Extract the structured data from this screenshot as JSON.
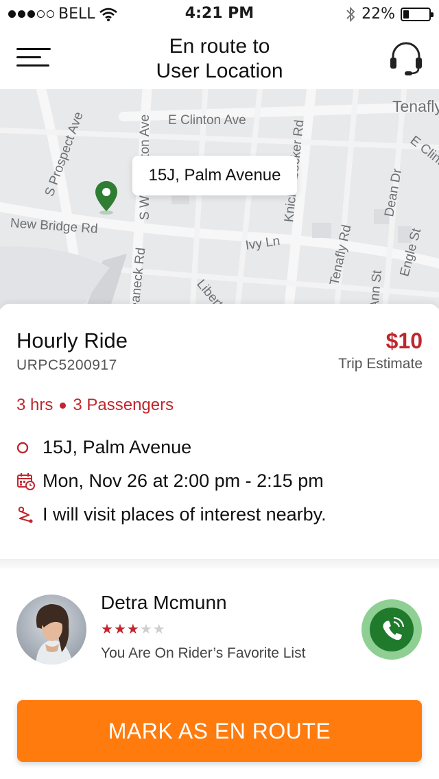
{
  "status_bar": {
    "carrier": "BELL",
    "time": "4:21 PM",
    "battery_text": "22%",
    "battery_level": 0.22,
    "signal_filled": 3,
    "signal_total": 5
  },
  "header": {
    "title": "En route to User Location",
    "title_line1": "En route to",
    "title_line2": "User Location",
    "menu_icon": "hamburger-menu-icon",
    "support_icon": "headset-icon"
  },
  "map": {
    "callout": "15J, Palm Avenue",
    "labels": {
      "prospect": "S Prospect Ave",
      "washington": "S Washington Ave",
      "clinton": "E Clinton Ave",
      "knick": "Knickerbocker Rd",
      "tenafly_town": "Tenafly",
      "eclin": "E Clinton Ave",
      "dean": "Dean Dr",
      "new_bridge": "New Bridge Rd",
      "ivy": "Ivy Ln",
      "tenafly_rd": "Tenafly Rd",
      "engle": "Engle St",
      "teaneck": "Teaneck Rd",
      "liberty": "Liberty",
      "ann": "Ann St"
    },
    "pin_color": "#2e7d32"
  },
  "trip": {
    "ride_type": "Hourly Ride",
    "ride_id": "URPC5200917",
    "fare": "$10",
    "fare_label": "Trip Estimate",
    "duration": "3 hrs",
    "passengers": "3 Passengers",
    "pickup": "15J, Palm Avenue",
    "schedule": "Mon, Nov 26 at 2:00 pm - 2:15 pm",
    "note": "I will visit places of interest nearby."
  },
  "rider": {
    "name": "Detra Mcmunn",
    "rating": 3,
    "rating_max": 5,
    "note": "You Are On Rider’s Favorite List"
  },
  "action": {
    "label": "MARK AS EN ROUTE"
  },
  "colors": {
    "accent": "#c0262d",
    "action": "#ff7b0d",
    "call": "#1f7a2c"
  }
}
